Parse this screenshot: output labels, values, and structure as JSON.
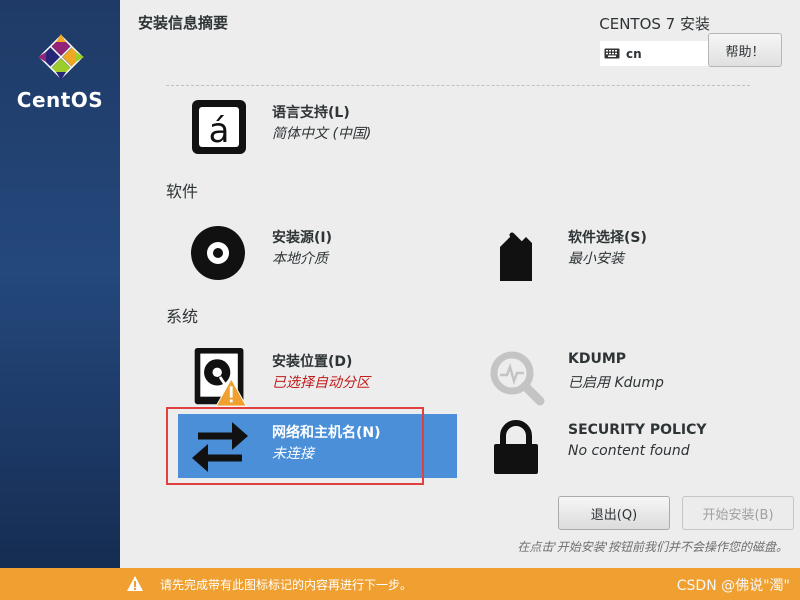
{
  "brand": {
    "name": "CentOS"
  },
  "header": {
    "title": "安装信息摘要",
    "product": "CENTOS 7 安装",
    "keyboard_layout": "cn",
    "help_label": "帮助！"
  },
  "sections": {
    "localization": {
      "language": {
        "title": "语言支持(L)",
        "status": "简体中文 (中国)",
        "icon": "language-icon"
      }
    },
    "software": {
      "label": "软件",
      "source": {
        "title": "安装源(I)",
        "status": "本地介质",
        "icon": "disc-icon"
      },
      "selection": {
        "title": "软件选择(S)",
        "status": "最小安装",
        "icon": "package-icon"
      }
    },
    "system": {
      "label": "系统",
      "destination": {
        "title": "安装位置(D)",
        "status": "已选择自动分区",
        "icon": "hard-drive-warning-icon"
      },
      "kdump": {
        "title": "KDUMP",
        "status": "已启用 Kdump",
        "icon": "magnifier-icon"
      },
      "network": {
        "title": "网络和主机名(N)",
        "status": "未连接",
        "icon": "network-arrows-icon"
      },
      "security": {
        "title": "SECURITY POLICY",
        "status": "No content found",
        "icon": "padlock-icon"
      }
    }
  },
  "actions": {
    "quit_label": "退出(Q)",
    "begin_label": "开始安装(B)",
    "note": "在点击'开始安装'按钮前我们并不会操作您的磁盘。"
  },
  "warning_bar": {
    "text": "请先完成带有此图标标记的内容再进行下一步。",
    "watermark": "CSDN @佛说\"濁\""
  },
  "colors": {
    "sidebar": "#24487c",
    "selected_spoke": "#4a8fd8",
    "warning_bar": "#f0a030",
    "warning_status": "#c01c1c",
    "highlight_box": "#e04040"
  }
}
